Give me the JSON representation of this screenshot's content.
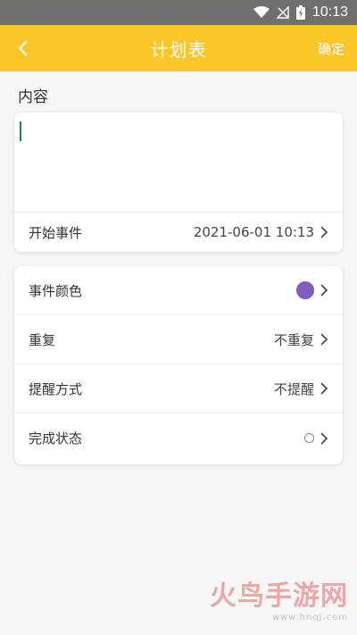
{
  "status_bar": {
    "time": "10:13"
  },
  "app_bar": {
    "title": "计划表",
    "confirm_label": "确定"
  },
  "content_section": {
    "label": "内容",
    "value": ""
  },
  "start": {
    "label": "开始事件",
    "value": "2021-06-01 10:13"
  },
  "settings": [
    {
      "label": "事件颜色",
      "value": "",
      "kind": "color",
      "color": "#7f5dbd"
    },
    {
      "label": "重复",
      "value": "不重复",
      "kind": "text"
    },
    {
      "label": "提醒方式",
      "value": "不提醒",
      "kind": "text"
    },
    {
      "label": "完成状态",
      "value": "",
      "kind": "status"
    }
  ],
  "colors": {
    "accent": "#fbc62a",
    "event_color": "#7f5dbd"
  },
  "watermark": {
    "text": "火鸟手游网",
    "url": "www.hnqj.com"
  }
}
